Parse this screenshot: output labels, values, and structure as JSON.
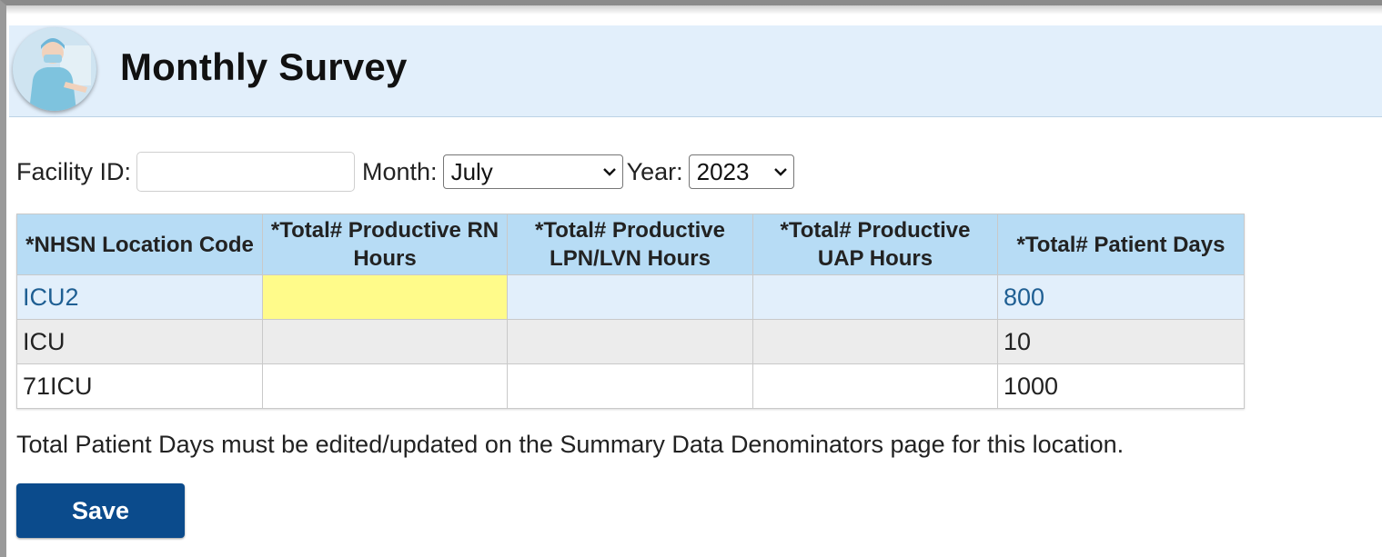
{
  "header": {
    "title": "Monthly Survey"
  },
  "filters": {
    "facility_label": "Facility ID:",
    "facility_value": "",
    "month_label": "Month:",
    "month_value": "July",
    "year_label": "Year:",
    "year_value": "2023"
  },
  "table": {
    "columns": [
      "*NHSN Location Code",
      "*Total# Productive RN Hours",
      "*Total# Productive LPN/LVN Hours",
      "*Total# Productive UAP Hours",
      "*Total# Patient Days"
    ],
    "rows": [
      {
        "location": "ICU2",
        "rn_hours": "",
        "lpn_hours": "",
        "uap_hours": "",
        "patient_days": "800"
      },
      {
        "location": "ICU",
        "rn_hours": "",
        "lpn_hours": "",
        "uap_hours": "",
        "patient_days": "10"
      },
      {
        "location": "71ICU",
        "rn_hours": "",
        "lpn_hours": "",
        "uap_hours": "",
        "patient_days": "1000"
      }
    ]
  },
  "note": "Total Patient Days must be edited/updated on the Summary Data Denominators page for this location.",
  "save_label": "Save",
  "colors": {
    "header_bg": "#e2effb",
    "table_header_bg": "#b7dcf5",
    "active_cell": "#fffb8a",
    "save_button": "#0b4b8c",
    "link_text": "#1f5f93"
  },
  "icons": {
    "avatar": "nurse-avatar-icon",
    "dropdown": "chevron-down-icon"
  }
}
